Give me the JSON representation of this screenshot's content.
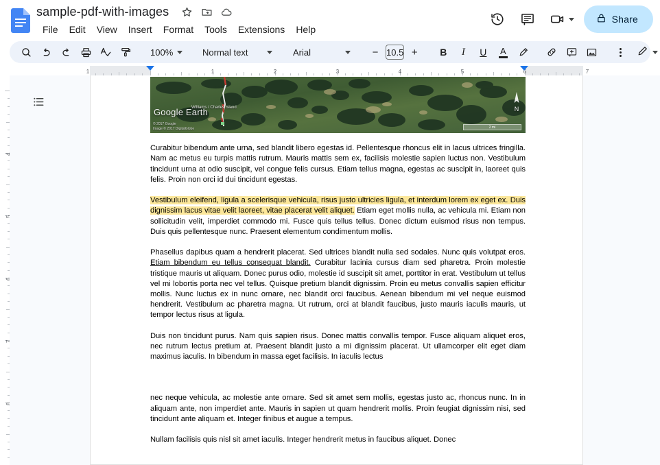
{
  "app": {
    "doc_title": "sample-pdf-with-images",
    "title_icons": [
      {
        "name": "star-icon",
        "label": "Star"
      },
      {
        "name": "move-folder-icon",
        "label": "Move"
      },
      {
        "name": "cloud-saved-icon",
        "label": "See document status"
      }
    ],
    "menus": [
      "File",
      "Edit",
      "View",
      "Insert",
      "Format",
      "Tools",
      "Extensions",
      "Help"
    ],
    "header_actions": [
      {
        "name": "version-history-icon",
        "label": "Version history"
      },
      {
        "name": "comment-history-icon",
        "label": "Open comment history"
      },
      {
        "name": "meet-camera-icon",
        "label": "Join or present in a meeting"
      }
    ],
    "share_label": "Share"
  },
  "toolbar": {
    "search_label": "Search",
    "undo_label": "Undo",
    "redo_label": "Redo",
    "print_label": "Print",
    "spellcheck_label": "Spelling and grammar check",
    "paint_format_label": "Paint format",
    "zoom_value": "100%",
    "style_value": "Normal text",
    "font_value": "Arial",
    "font_decrease": "−",
    "font_size_value": "10.5",
    "font_increase": "+",
    "bold_label": "B",
    "italic_label": "I",
    "underline_label": "U",
    "text_color_label": "A",
    "highlight_label": "Highlight color",
    "link_label": "Insert link",
    "comment_label": "Add comment",
    "image_label": "Insert image",
    "more_label": "More",
    "editing_mode_label": "Editing mode"
  },
  "ruler": {
    "horizontal_numbers": [
      "1",
      "1",
      "2",
      "3",
      "4",
      "5",
      "6",
      "7"
    ],
    "vertical_numbers": [
      "4",
      "5",
      "6",
      "7",
      "8",
      "9"
    ],
    "left_indent_marker": "left-indent-marker",
    "right_indent_marker": "right-indent-marker"
  },
  "sidebar": {
    "outline_label": "Show document outline"
  },
  "document": {
    "image": {
      "name": "google-earth-satellite-image",
      "watermark": "Google Earth",
      "credit_line1": "© 2017 Google",
      "credit_line2": "Image © 2017 DigitalGlobe",
      "place_label": "Williams / Charles Island",
      "scale_label": "2 mi",
      "compass_label": "N"
    },
    "paragraphs": [
      {
        "name": "paragraph-1",
        "runs": [
          {
            "text": "Curabitur bibendum ante urna, sed blandit libero egestas id. Pellentesque rhoncus elit in lacus ultrices fringilla. Nam ac metus eu turpis mattis rutrum. Mauris mattis sem ex, facilisis molestie sapien luctus non. Vestibulum tincidunt urna at odio suscipit, vel congue felis cursus. Etiam tellus magna, egestas ac suscipit in, laoreet quis felis. Proin non orci id dui tincidunt egestas.",
            "style": "plain"
          }
        ]
      },
      {
        "name": "paragraph-2",
        "runs": [
          {
            "text": "Vestibulum eleifend, ligula a scelerisque vehicula, risus justo ultricies ligula, et interdum lorem ex eget ex. Duis dignissim lacus vitae velit laoreet, vitae placerat velit aliquet.",
            "style": "highlight"
          },
          {
            "text": " Etiam eget mollis nulla,  ac vehicula mi. Etiam non sollicitudin velit, imperdiet commodo mi. Fusce quis tellus tellus. Donec  dictum euismod risus non tempus. Duis quis pellentesque nunc. Praesent elementum condimentum mollis.",
            "style": "plain"
          }
        ]
      },
      {
        "name": "paragraph-3",
        "runs": [
          {
            "text": "Phasellus dapibus quam a hendrerit placerat. Sed ultrices blandit nulla sed sodales. Nunc quis volutpat eros. ",
            "style": "plain"
          },
          {
            "text": "Etiam bibendum eu tellus consequat blandit.",
            "style": "underline"
          },
          {
            "text": " Curabitur lacinia cursus diam sed pharetra. Proin molestie tristique mauris ut aliquam. Donec purus odio, molestie id suscipit sit amet, porttitor in erat. Vestibulum ut tellus vel mi lobortis porta nec vel tellus. Quisque pretium blandit dignissim. Proin eu metus convallis sapien efficitur mollis. Nunc luctus ex in nunc ornare, nec blandit orci faucibus. Aenean bibendum mi vel neque euismod hendrerit. Vestibulum ac pharetra magna. Ut rutrum, orci at blandit faucibus, justo mauris iaculis mauris, ut tempor lectus risus at ligula.",
            "style": "plain"
          }
        ]
      },
      {
        "name": "paragraph-4",
        "runs": [
          {
            "text": "Duis non tincidunt purus. Nam quis sapien risus. Donec mattis convallis tempor. Fusce aliquam aliquet eros, nec rutrum lectus pretium at. Praesent blandit justo a mi dignissim placerat. Ut ullamcorper elit eget diam maximus iaculis. In bibendum in massa eget facilisis. In iaculis lectus",
            "style": "plain"
          }
        ]
      },
      {
        "name": "paragraph-5",
        "runs": [
          {
            "text": "nec neque vehicula, ac molestie ante ornare. Sed sit amet sem mollis, egestas justo ac, rhoncus nunc. In in aliquam ante, non imperdiet ante. Mauris in sapien ut quam hendrerit mollis. Proin feugiat dignissim nisi, sed tincidunt ante aliquam et. Integer finibus et augue a tempus.",
            "style": "plain"
          }
        ]
      },
      {
        "name": "paragraph-6",
        "runs": [
          {
            "text": "Nullam facilisis quis nisl sit amet iaculis. Integer hendrerit metus in faucibus aliquet. Donec",
            "style": "plain"
          }
        ]
      }
    ]
  },
  "colors": {
    "accent": "#1a73e8",
    "share_bg": "#c2e7ff",
    "toolbar_bg": "#edf2fa",
    "highlight": "#fce79a",
    "workspace_bg": "#f8fafd"
  }
}
